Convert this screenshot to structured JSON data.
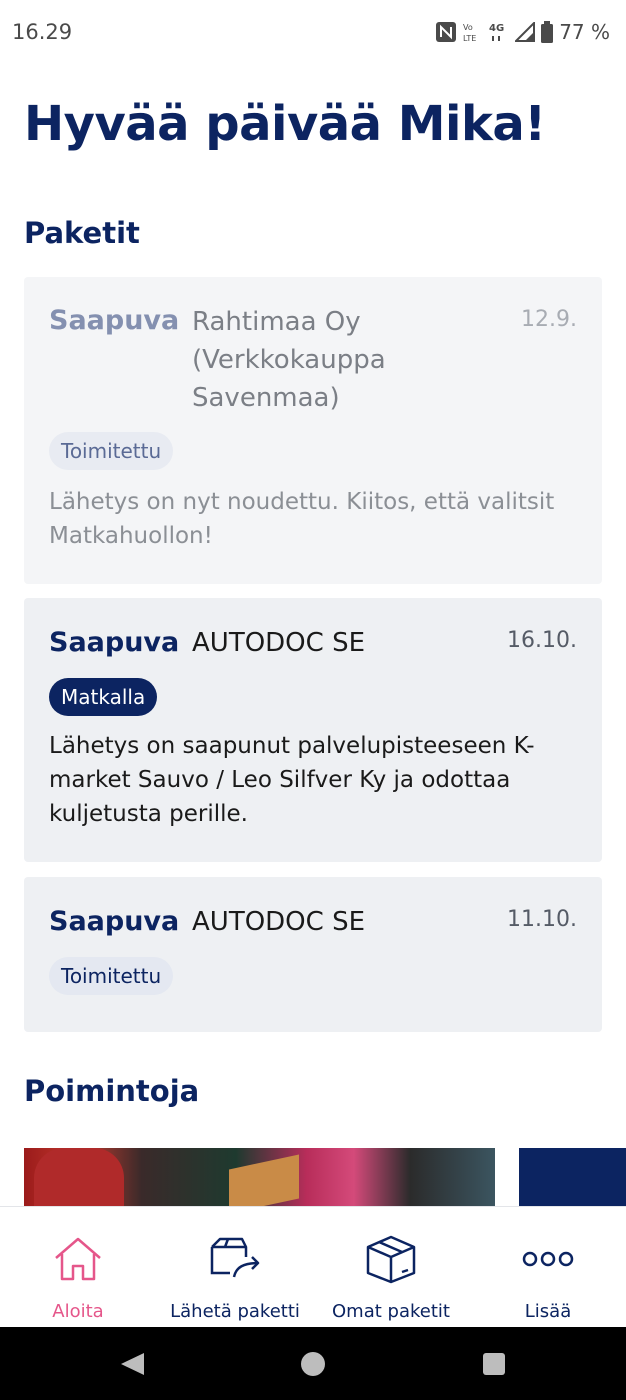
{
  "status_bar": {
    "time": "16.29",
    "battery": "77 %"
  },
  "greeting": "Hyvää päivää Mika!",
  "sections": {
    "packages": "Paketit",
    "picks": "Poimintoja"
  },
  "packages": [
    {
      "type": "Saapuva",
      "sender": "Rahtimaa Oy (Verkkokauppa Savenmaa)",
      "sender_lines": [
        "Rahtimaa Oy",
        "(Verkkokauppa",
        "Savenmaa)"
      ],
      "date": "12.9.",
      "status": "Toimitettu",
      "message": "Lähetys on nyt noudettu. Kiitos, että valitsit Matkahuollon!"
    },
    {
      "type": "Saapuva",
      "sender": "AUTODOC SE",
      "date": "16.10.",
      "status": "Matkalla",
      "message": "Lähetys on saapunut palvelupisteeseen K-market Sauvo / Leo Silfver Ky ja odottaa kuljetusta perille."
    },
    {
      "type": "Saapuva",
      "sender": "AUTODOC SE",
      "date": "11.10.",
      "status": "Toimitettu"
    }
  ],
  "bottom_nav": {
    "home": {
      "label": "Aloita",
      "icon": "home-icon",
      "active": true
    },
    "send": {
      "label": "Lähetä paketti",
      "icon": "send-package-icon"
    },
    "own": {
      "label": "Omat paketit",
      "icon": "package-box-icon"
    },
    "more": {
      "label": "Lisää",
      "icon": "more-dots-icon"
    }
  },
  "colors": {
    "brand_navy": "#0c2461",
    "active_pink": "#e5568a",
    "card_bg": "#eef0f3"
  }
}
